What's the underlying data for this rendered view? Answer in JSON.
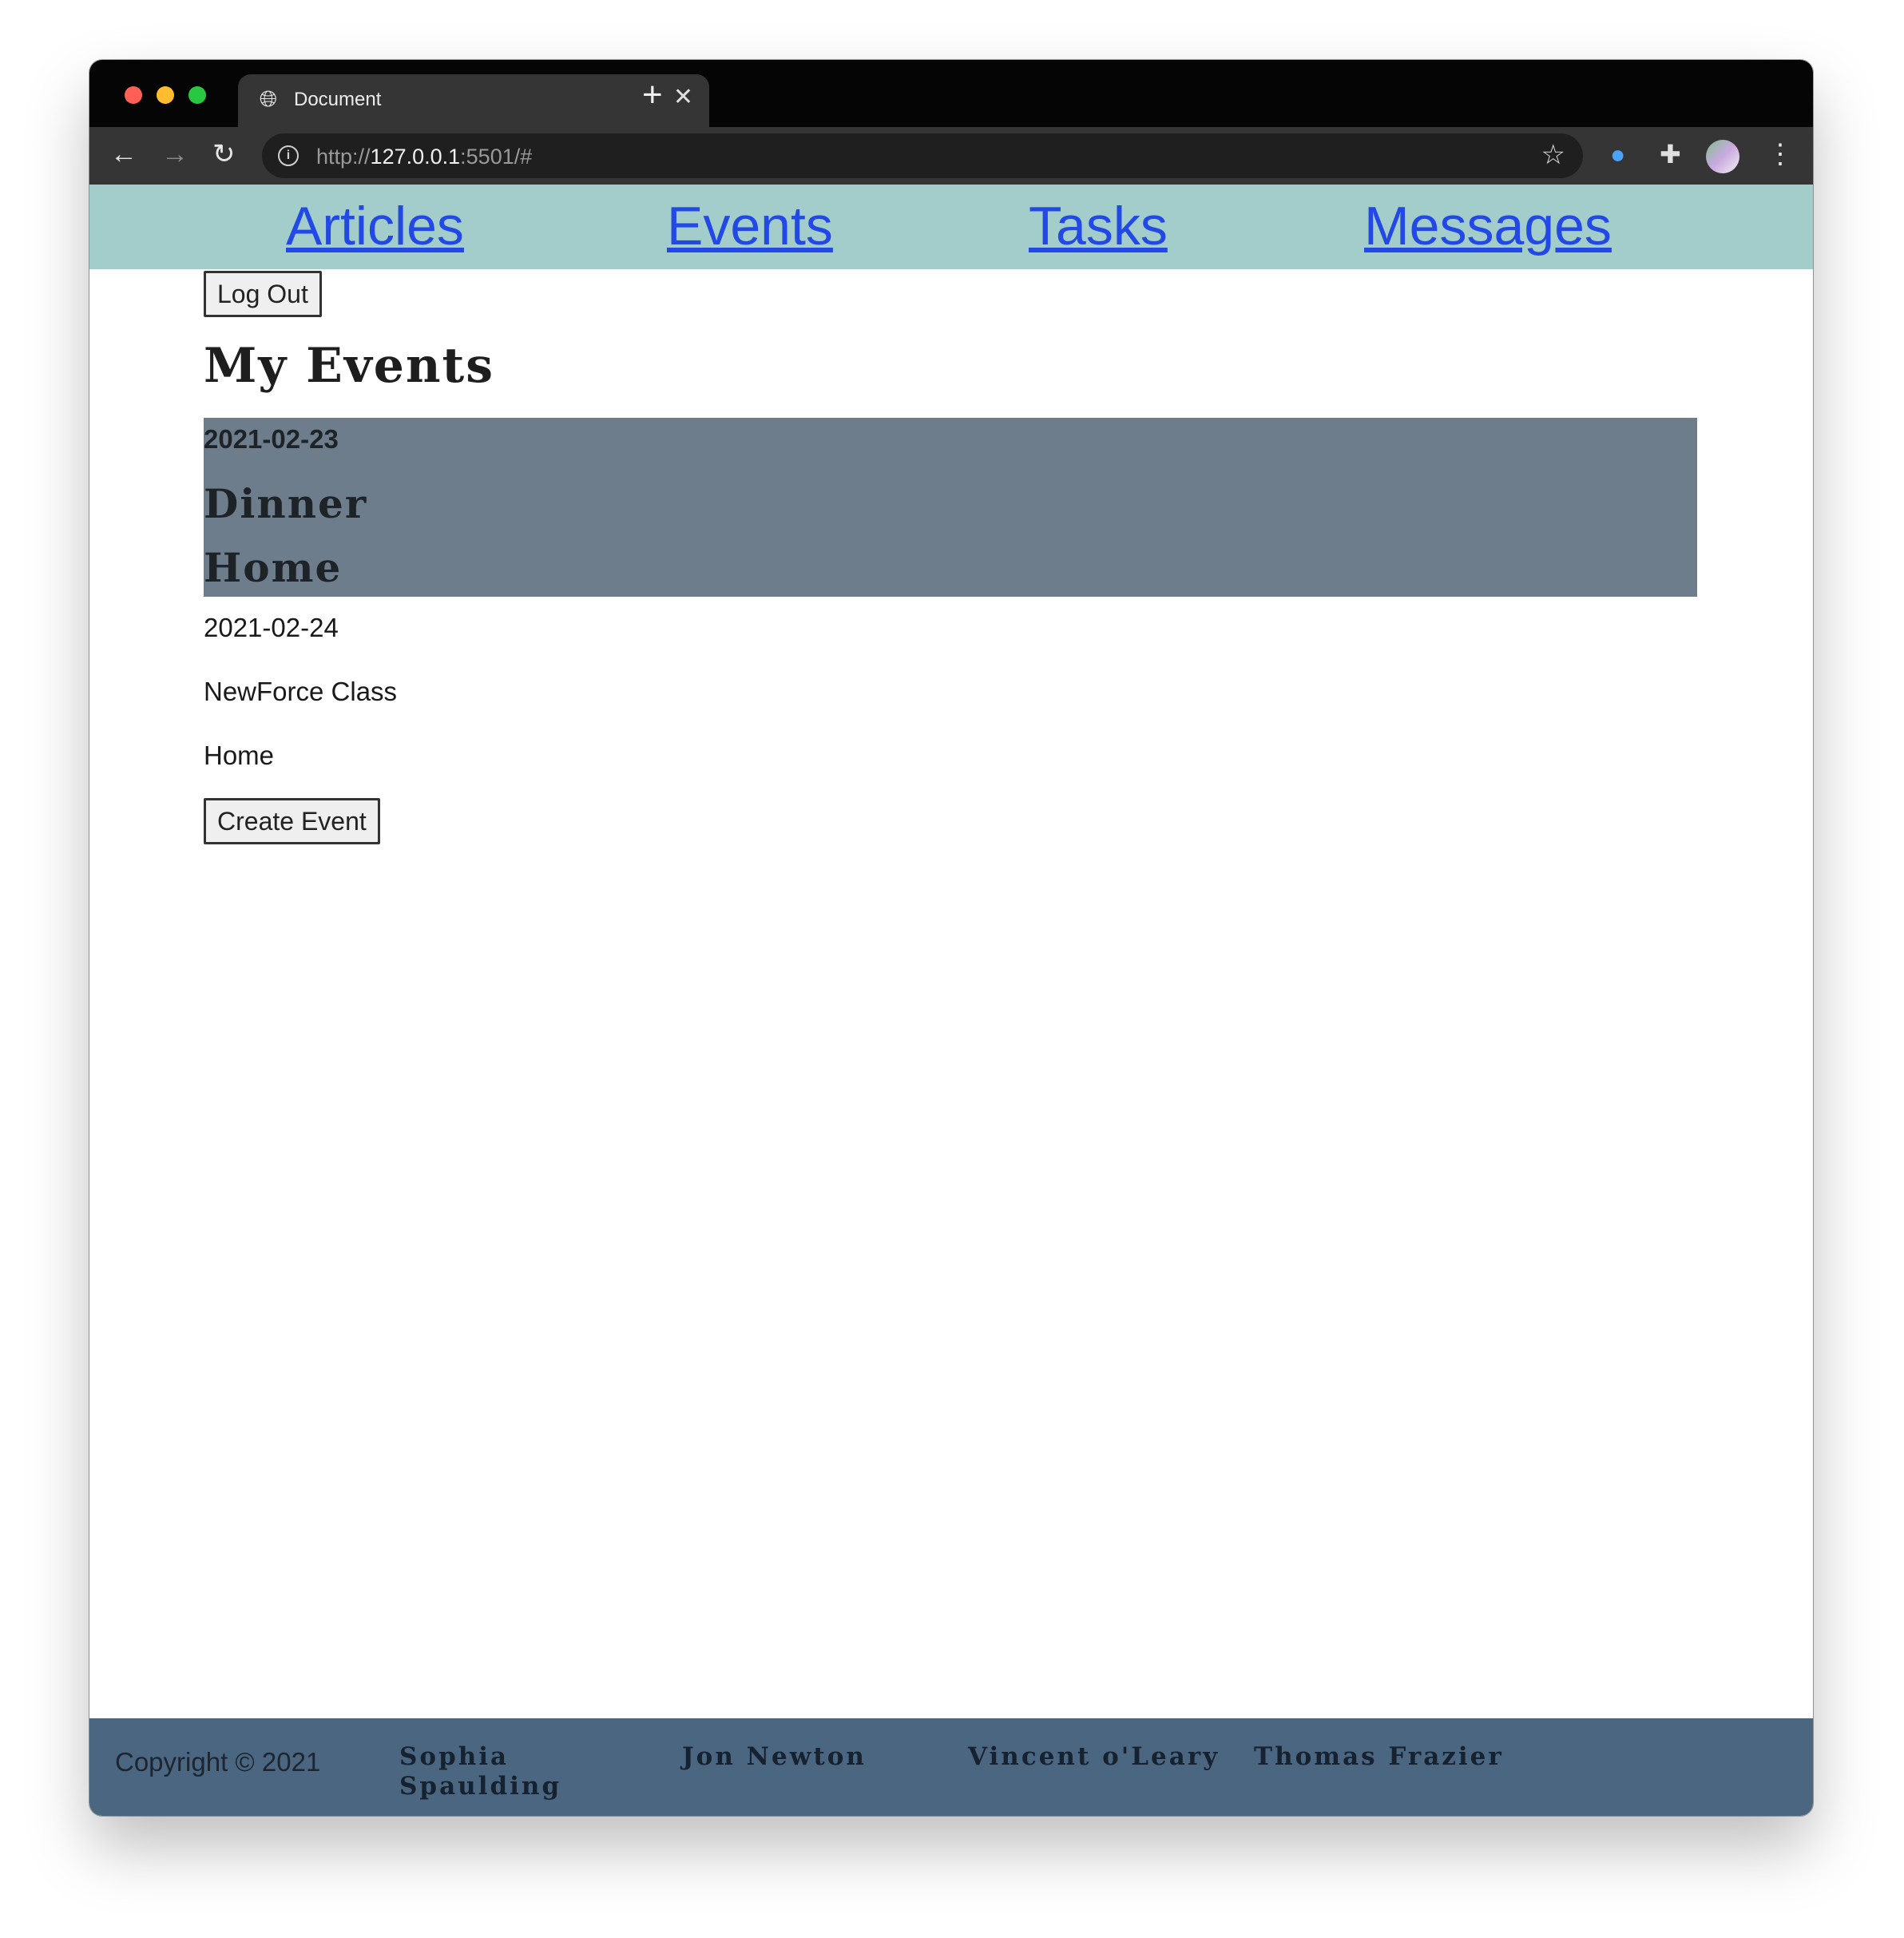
{
  "browser": {
    "tab_title": "Document",
    "url_scheme": "http://",
    "url_host": "127.0.0.1",
    "url_rest": ":5501/#",
    "icons": [
      "globe-icon",
      "close-icon",
      "plus-icon",
      "back-arrow-icon",
      "forward-arrow-icon",
      "reload-icon",
      "info-icon",
      "star-icon",
      "password-manager-icon",
      "puzzle-icon",
      "profile-avatar",
      "kebab-menu-icon"
    ]
  },
  "nav": {
    "articles": "Articles",
    "events": "Events",
    "tasks": "Tasks",
    "messages": "Messages",
    "background": "#a3cdca",
    "link_color": "#2249e6"
  },
  "page": {
    "logout_label": "Log Out",
    "title": "My Events",
    "create_label": "Create Event"
  },
  "events": [
    {
      "date": "2021-02-23",
      "name": "Dinner",
      "location": "Home",
      "highlighted": true,
      "highlight_color": "#6e7d8c"
    },
    {
      "date": "2021-02-24",
      "name": "NewForce Class",
      "location": "Home",
      "highlighted": false
    }
  ],
  "footer": {
    "copyright": "Copyright © 2021",
    "authors": [
      "Sophia Spaulding",
      "Jon Newton",
      "Vincent o'Leary",
      "Thomas Frazier"
    ],
    "background": "#4b6680"
  }
}
